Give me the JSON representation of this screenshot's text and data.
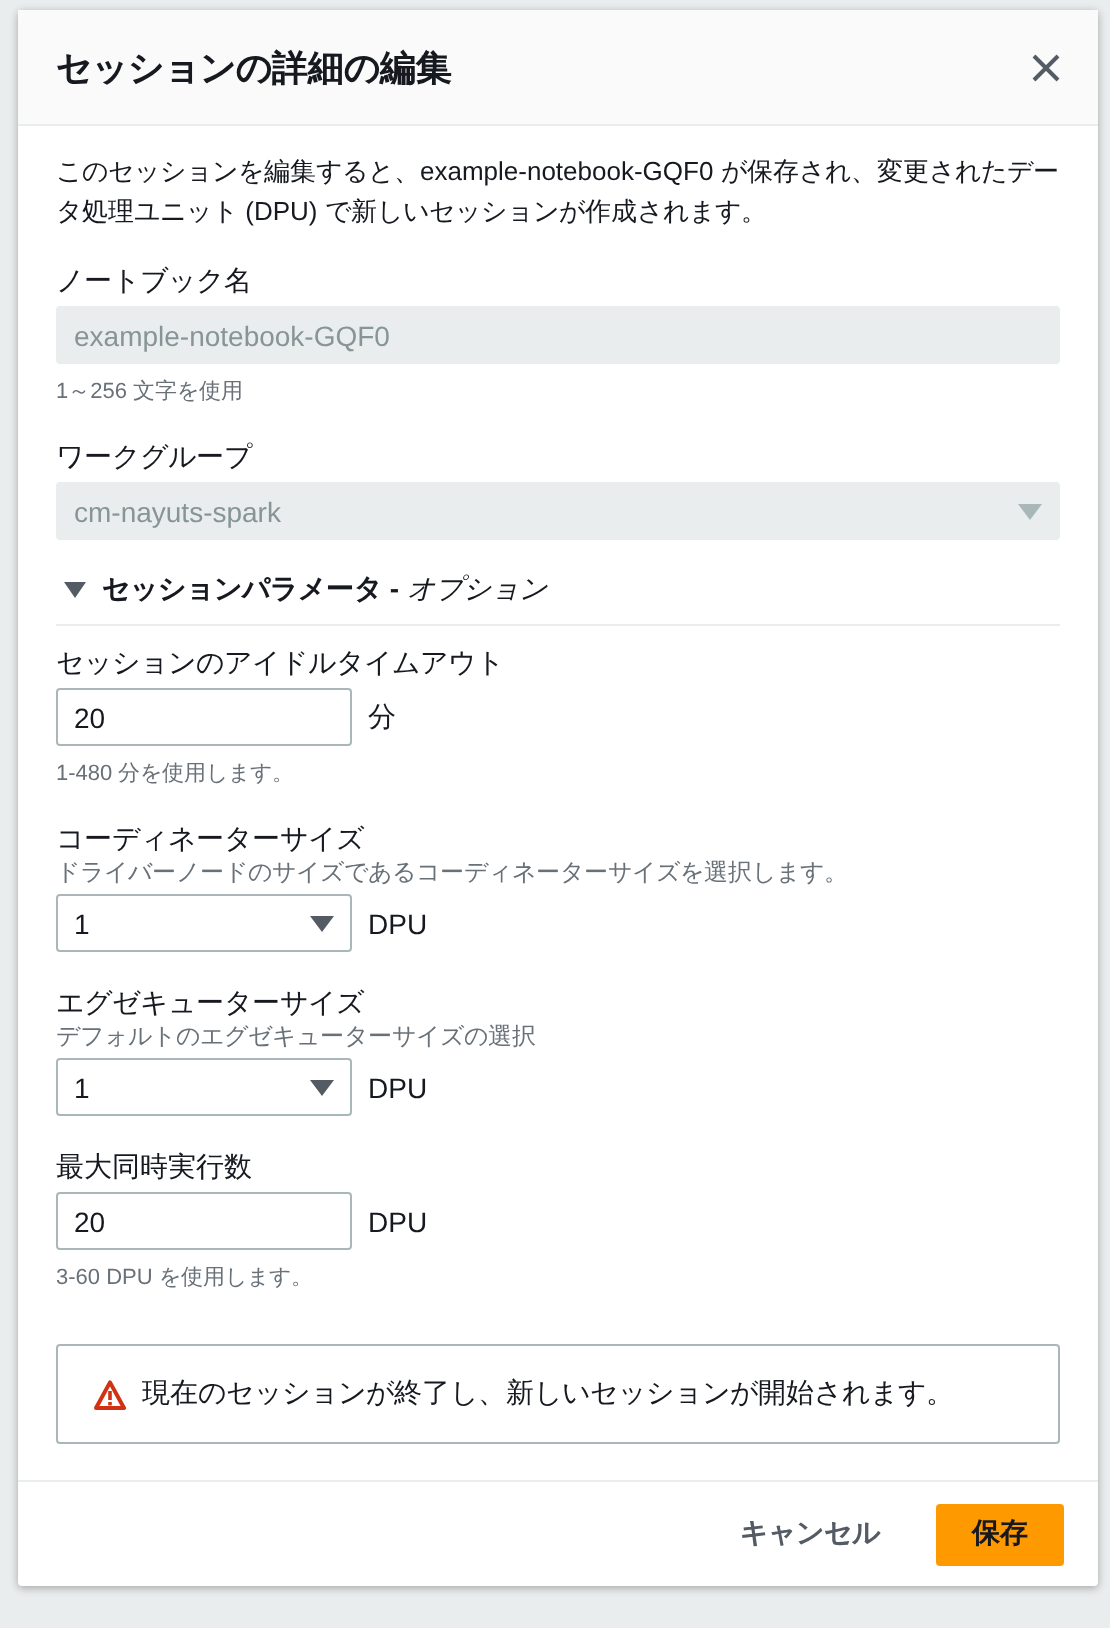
{
  "dialog": {
    "title": "セッションの詳細の編集"
  },
  "description": "このセッションを編集すると、example-notebook-GQF0 が保存され、変更されたデータ処理ユニット (DPU) で新しいセッションが作成されます。",
  "fields": [
    {
      "kind": "text",
      "label": "ノートブック名",
      "value": "example-notebook-GQF0",
      "disabled": true,
      "hint": "1～256 文字を使用"
    },
    {
      "kind": "select",
      "label": "ワークグループ",
      "value": "cm-nayuts-spark",
      "disabled": true
    }
  ],
  "section": {
    "title": "セッションパラメータ",
    "separator": "-",
    "suffix": "オプション",
    "expanded": true
  },
  "parameters": [
    {
      "kind": "text",
      "label": "セッションのアイドルタイムアウト",
      "value": "20",
      "unit": "分",
      "hint": "1-480 分を使用します。",
      "disabled": false
    },
    {
      "kind": "select",
      "label": "コーディネーターサイズ",
      "description": "ドライバーノードのサイズであるコーディネーターサイズを選択します。",
      "value": "1",
      "unit": "DPU",
      "disabled": false
    },
    {
      "kind": "select",
      "label": "エグゼキューターサイズ",
      "description": "デフォルトのエグゼキューターサイズの選択",
      "value": "1",
      "unit": "DPU",
      "disabled": false
    },
    {
      "kind": "text",
      "label": "最大同時実行数",
      "value": "20",
      "unit": "DPU",
      "hint": "3-60 DPU を使用します。",
      "disabled": false
    }
  ],
  "alert": {
    "text": "現在のセッションが終了し、新しいセッションが開始されます。"
  },
  "buttons": [
    {
      "label": "キャンセル",
      "kind": "link"
    },
    {
      "label": "保存",
      "kind": "primary"
    }
  ]
}
